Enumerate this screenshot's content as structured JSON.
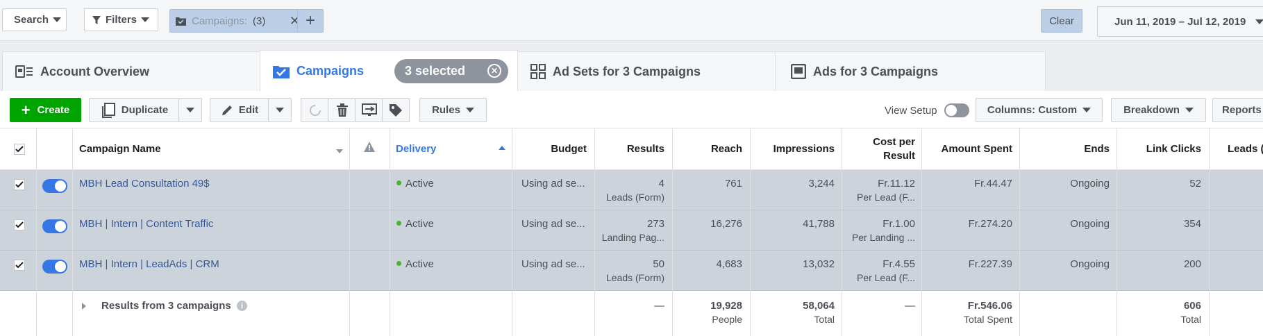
{
  "topbar": {
    "search_label": "Search",
    "filters_label": "Filters",
    "campaigns_chip_label": "Campaigns:",
    "campaigns_chip_count": "(3)",
    "clear_label": "Clear",
    "date_range": "Jun 11, 2019 – Jul 12, 2019"
  },
  "tabs": {
    "account_overview": "Account Overview",
    "campaigns": "Campaigns",
    "selected_pill": "3 selected",
    "ad_sets": "Ad Sets for 3 Campaigns",
    "ads": "Ads for 3 Campaigns"
  },
  "toolbar": {
    "create": "Create",
    "duplicate": "Duplicate",
    "edit": "Edit",
    "rules": "Rules",
    "view_setup": "View Setup",
    "columns": "Columns: Custom",
    "breakdown": "Breakdown",
    "reports": "Reports"
  },
  "table": {
    "headers": {
      "campaign_name": "Campaign Name",
      "delivery": "Delivery",
      "budget": "Budget",
      "results": "Results",
      "reach": "Reach",
      "impressions": "Impressions",
      "cost_per_result_1": "Cost per",
      "cost_per_result_2": "Result",
      "amount_spent": "Amount Spent",
      "ends": "Ends",
      "link_clicks": "Link Clicks",
      "leads": "Leads ("
    },
    "rows": [
      {
        "name": "MBH Lead Consultation 49$",
        "delivery": "Active",
        "budget": "Using ad se...",
        "results": "4",
        "results_sub": "Leads (Form)",
        "reach": "761",
        "impressions": "3,244",
        "cost": "Fr.11.12",
        "cost_sub": "Per Lead (F...",
        "spent": "Fr.44.47",
        "ends": "Ongoing",
        "clicks": "52"
      },
      {
        "name": "MBH | Intern | Content Traffic",
        "delivery": "Active",
        "budget": "Using ad se...",
        "results": "273",
        "results_sub": "Landing Pag...",
        "reach": "16,276",
        "impressions": "41,788",
        "cost": "Fr.1.00",
        "cost_sub": "Per Landing ...",
        "spent": "Fr.274.20",
        "ends": "Ongoing",
        "clicks": "354"
      },
      {
        "name": "MBH | Intern | LeadAds | CRM",
        "delivery": "Active",
        "budget": "Using ad se...",
        "results": "50",
        "results_sub": "Leads (Form)",
        "reach": "4,683",
        "impressions": "13,032",
        "cost": "Fr.4.55",
        "cost_sub": "Per Lead (F...",
        "spent": "Fr.227.39",
        "ends": "Ongoing",
        "clicks": "200"
      }
    ],
    "summary": {
      "label": "Results from 3 campaigns",
      "results": "—",
      "reach": "19,928",
      "reach_sub": "People",
      "impressions": "58,064",
      "impressions_sub": "Total",
      "cost": "—",
      "spent": "Fr.546.06",
      "spent_sub": "Total Spent",
      "clicks": "606",
      "clicks_sub": "Total"
    }
  },
  "colors": {
    "accent": "#3578e5",
    "create": "#00a400",
    "active_dot": "#42b72a"
  }
}
